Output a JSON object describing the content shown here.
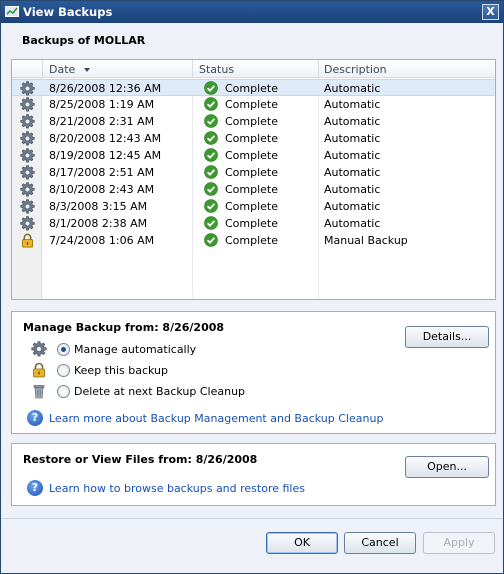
{
  "window": {
    "title": "View Backups",
    "close_label": "X"
  },
  "heading": "Backups of MOLLAR",
  "columns": {
    "date": "Date",
    "status": "Status",
    "description": "Description"
  },
  "rows": [
    {
      "icon": "gear-icon",
      "date": "8/26/2008 12:36 AM",
      "status": "Complete",
      "description": "Automatic"
    },
    {
      "icon": "gear-icon",
      "date": "8/25/2008 1:19 AM",
      "status": "Complete",
      "description": "Automatic"
    },
    {
      "icon": "gear-icon",
      "date": "8/21/2008 2:31 AM",
      "status": "Complete",
      "description": "Automatic"
    },
    {
      "icon": "gear-icon",
      "date": "8/20/2008 12:43 AM",
      "status": "Complete",
      "description": "Automatic"
    },
    {
      "icon": "gear-icon",
      "date": "8/19/2008 12:45 AM",
      "status": "Complete",
      "description": "Automatic"
    },
    {
      "icon": "gear-icon",
      "date": "8/17/2008 2:51 AM",
      "status": "Complete",
      "description": "Automatic"
    },
    {
      "icon": "gear-icon",
      "date": "8/10/2008 2:43 AM",
      "status": "Complete",
      "description": "Automatic"
    },
    {
      "icon": "gear-icon",
      "date": "8/3/2008 3:15 AM",
      "status": "Complete",
      "description": "Automatic"
    },
    {
      "icon": "gear-icon",
      "date": "8/1/2008 2:38 AM",
      "status": "Complete",
      "description": "Automatic"
    },
    {
      "icon": "lock-icon",
      "date": "7/24/2008 1:06 AM",
      "status": "Complete",
      "description": "Manual Backup"
    }
  ],
  "manage": {
    "title": "Manage Backup from: 8/26/2008",
    "details_label": "Details...",
    "options": [
      {
        "icon": "gear-icon",
        "label": "Manage automatically",
        "selected": true
      },
      {
        "icon": "lock-icon",
        "label": "Keep this backup",
        "selected": false
      },
      {
        "icon": "trash-icon",
        "label": "Delete at next Backup Cleanup",
        "selected": false
      }
    ],
    "help_link": "Learn more about Backup Management and Backup Cleanup"
  },
  "restore": {
    "title": "Restore or View Files from: 8/26/2008",
    "open_label": "Open...",
    "help_link": "Learn how to browse backups and restore files"
  },
  "buttons": {
    "ok": "OK",
    "cancel": "Cancel",
    "apply": "Apply"
  },
  "colors": {
    "titlebar": "#1f4f86",
    "selection": "#dfeaf9",
    "link": "#1650b4",
    "window_bg": "#eef2f8"
  }
}
